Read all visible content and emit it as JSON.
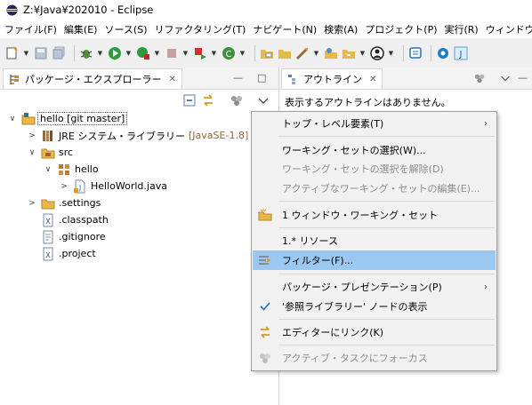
{
  "window": {
    "title": "Z:¥Java¥202010 - Eclipse"
  },
  "menubar": {
    "items": [
      "ファイル(F)",
      "編集(E)",
      "ソース(S)",
      "リファクタリング(T)",
      "ナビゲート(N)",
      "検索(A)",
      "プロジェクト(P)",
      "実行(R)",
      "ウィンドウ(W)"
    ]
  },
  "left_view": {
    "tab_label": "パッケージ・エクスプローラー",
    "close_glyph": "✕",
    "minimize_glyph": "—",
    "maximize_glyph": "□"
  },
  "tree": {
    "items": [
      {
        "label": "hello [git master]",
        "decoration": "",
        "twisty": "∨"
      },
      {
        "label": "JRE システム・ライブラリー",
        "decoration": "[JavaSE-1.8]",
        "twisty": ">"
      },
      {
        "label": "src",
        "decoration": "",
        "twisty": "∨"
      },
      {
        "label": "hello",
        "decoration": "",
        "twisty": "∨"
      },
      {
        "label": "HelloWorld.java",
        "decoration": "",
        "twisty": ">"
      },
      {
        "label": ".settings",
        "decoration": "",
        "twisty": ">"
      },
      {
        "label": ".classpath",
        "decoration": "",
        "twisty": ""
      },
      {
        "label": ".gitignore",
        "decoration": "",
        "twisty": ""
      },
      {
        "label": ".project",
        "decoration": "",
        "twisty": ""
      }
    ]
  },
  "right_view": {
    "tab_label": "アウトライン",
    "close_glyph": "✕",
    "message": "表示するアウトラインはありません。"
  },
  "context_menu": {
    "items": [
      {
        "label": "トップ・レベル要素(T)",
        "submenu": "›",
        "enabled": true
      },
      {
        "label": "ワーキング・セットの選択(W)...",
        "submenu": "",
        "enabled": true
      },
      {
        "label": "ワーキング・セットの選択を解除(D)",
        "submenu": "",
        "enabled": false
      },
      {
        "label": "アクティブなワーキング・セットの編集(E)...",
        "submenu": "",
        "enabled": false
      },
      {
        "label": "1 ウィンドウ・ワーキング・セット",
        "submenu": "",
        "enabled": true
      },
      {
        "label": "1.* リソース",
        "submenu": "",
        "enabled": true
      },
      {
        "label": "フィルター(F)...",
        "submenu": "",
        "enabled": true,
        "highlighted": true
      },
      {
        "label": "パッケージ・プレゼンテーション(P)",
        "submenu": "›",
        "enabled": true
      },
      {
        "label": "'参照ライブラリー' ノードの表示",
        "submenu": "",
        "enabled": true,
        "checked": true
      },
      {
        "label": "エディターにリンク(K)",
        "submenu": "",
        "enabled": true
      },
      {
        "label": "アクティブ・タスクにフォーカス",
        "submenu": "",
        "enabled": false
      }
    ]
  },
  "colors": {
    "highlight": "#9bc8f0",
    "disabled_text": "#8d8d8d",
    "decoration_text": "#8a6d3b",
    "check": "#1f6fc2"
  }
}
